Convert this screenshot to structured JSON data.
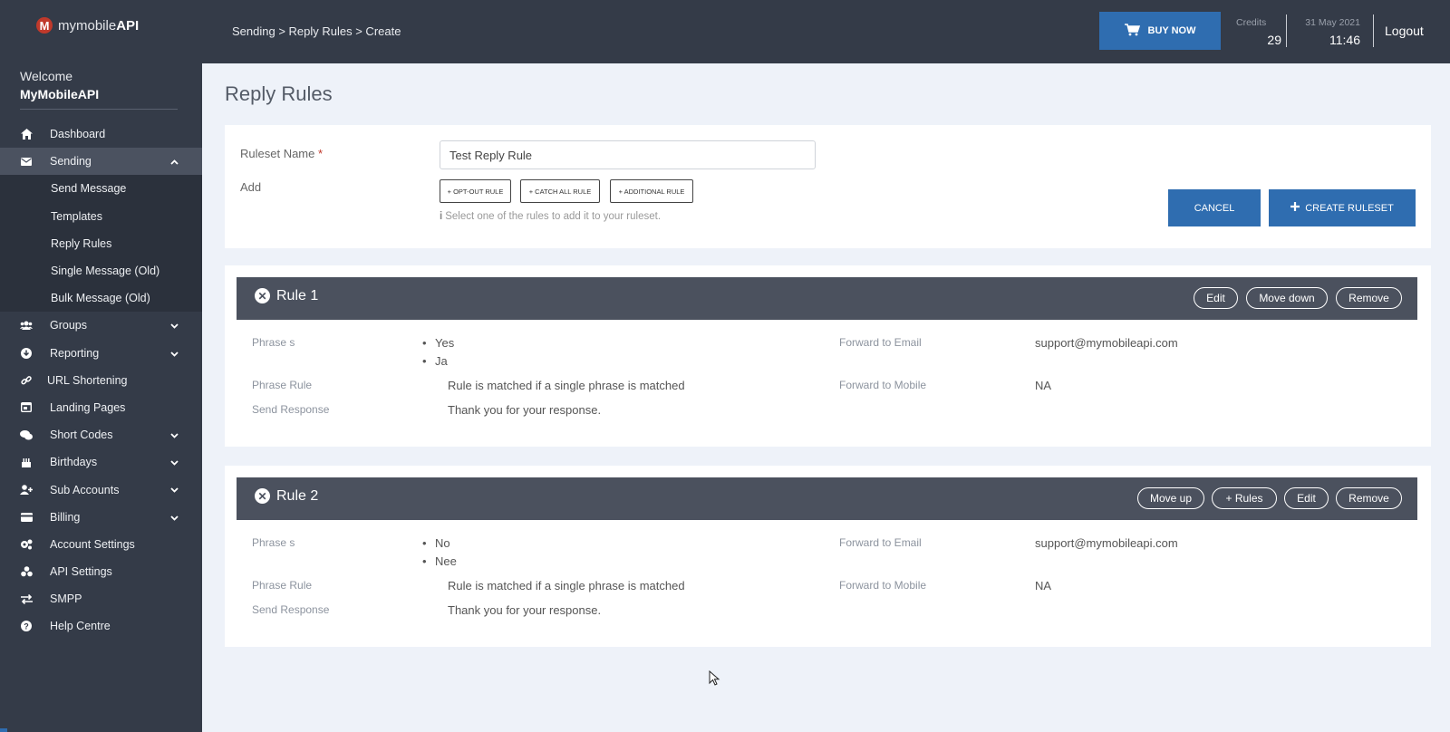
{
  "brand": {
    "logo_letter": "M",
    "name_prefix": "mymobile",
    "name_suffix": "API"
  },
  "welcome": {
    "label": "Welcome",
    "name": "MyMobileAPI"
  },
  "sidebar": {
    "items": [
      {
        "label": "Dashboard",
        "icon": "home-icon"
      },
      {
        "label": "Sending",
        "icon": "envelope-icon",
        "expanded": true,
        "children": [
          "Send Message",
          "Templates",
          "Reply Rules",
          "Single Message (Old)",
          "Bulk Message (Old)"
        ]
      },
      {
        "label": "Groups",
        "icon": "users-icon"
      },
      {
        "label": "Reporting",
        "icon": "download-icon"
      },
      {
        "label": "URL Shortening",
        "icon": "link-icon"
      },
      {
        "label": "Landing Pages",
        "icon": "window-icon"
      },
      {
        "label": "Short Codes",
        "icon": "chat-icon"
      },
      {
        "label": "Birthdays",
        "icon": "cake-icon"
      },
      {
        "label": "Sub Accounts",
        "icon": "user-plus-icon"
      },
      {
        "label": "Billing",
        "icon": "card-icon"
      },
      {
        "label": "Account Settings",
        "icon": "cogs-icon"
      },
      {
        "label": "API Settings",
        "icon": "api-icon"
      },
      {
        "label": "SMPP",
        "icon": "exchange-icon"
      },
      {
        "label": "Help Centre",
        "icon": "question-icon"
      }
    ]
  },
  "topbar": {
    "breadcrumb": "Sending > Reply Rules > Create",
    "buy_label": "BUY NOW",
    "credits_label": "Credits",
    "credits_value": "29",
    "date": "31 May 2021",
    "time": "11:46",
    "logout": "Logout"
  },
  "page": {
    "title": "Reply Rules"
  },
  "form": {
    "ruleset_label": "Ruleset Name",
    "required_mark": "*",
    "ruleset_value": "Test Reply Rule",
    "add_label": "Add",
    "add_buttons": [
      "+ OPT-OUT RULE",
      "+ CATCH ALL RULE",
      "+ ADDITIONAL RULE"
    ],
    "hint": "Select one of the rules to add it to your ruleset.",
    "cancel_label": "CANCEL",
    "create_label": "CREATE RULESET"
  },
  "field_labels": {
    "phrases": "Phrase s",
    "phrase_rule": "Phrase Rule",
    "send_response": "Send Response",
    "forward_email": "Forward to Email",
    "forward_mobile": "Forward to Mobile"
  },
  "rules": [
    {
      "title": "Rule 1",
      "buttons": [
        "Edit",
        "Move down",
        "Remove"
      ],
      "phrases": [
        "Yes",
        "Ja"
      ],
      "phrase_rule": "Rule is matched if a single phrase is matched",
      "send_response": "Thank you for your response.",
      "forward_email": "support@mymobileapi.com",
      "forward_mobile": "NA"
    },
    {
      "title": "Rule 2",
      "buttons": [
        "Move up",
        "+ Rules",
        "Edit",
        "Remove"
      ],
      "phrases": [
        "No",
        "Nee"
      ],
      "phrase_rule": "Rule is matched if a single phrase is matched",
      "send_response": "Thank you for your response.",
      "forward_email": "support@mymobileapi.com",
      "forward_mobile": "NA"
    }
  ],
  "colors": {
    "sidebar": "#343b48",
    "accent": "#2f6db0",
    "rule_header": "#4b515e",
    "background": "#eef2f9"
  }
}
